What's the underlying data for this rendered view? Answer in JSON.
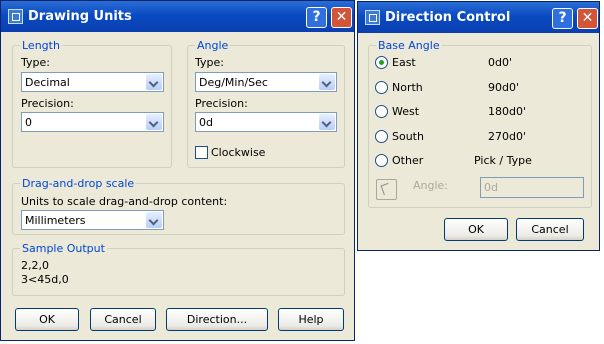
{
  "drawing_units": {
    "title": "Drawing Units",
    "help_label": "?",
    "close_label": "✕",
    "length": {
      "legend": "Length",
      "type_label": "Type:",
      "type_value": "Decimal",
      "precision_label": "Precision:",
      "precision_value": "0"
    },
    "angle": {
      "legend": "Angle",
      "type_label": "Type:",
      "type_value": "Deg/Min/Sec",
      "precision_label": "Precision:",
      "precision_value": "0d",
      "clockwise_label": "Clockwise",
      "clockwise_checked": false
    },
    "drag_drop": {
      "legend": "Drag-and-drop scale",
      "units_label": "Units to scale drag-and-drop content:",
      "units_value": "Millimeters"
    },
    "sample_output": {
      "legend": "Sample Output",
      "line1": "2,2,0",
      "line2": "3<45d,0"
    },
    "buttons": {
      "ok": "OK",
      "cancel": "Cancel",
      "direction": "Direction...",
      "help": "Help"
    }
  },
  "direction_control": {
    "title": "Direction Control",
    "help_label": "?",
    "close_label": "✕",
    "base_angle": {
      "legend": "Base Angle",
      "options": [
        {
          "label": "East",
          "value": "0d0'",
          "selected": true
        },
        {
          "label": "North",
          "value": "90d0'",
          "selected": false
        },
        {
          "label": "West",
          "value": "180d0'",
          "selected": false
        },
        {
          "label": "South",
          "value": "270d0'",
          "selected": false
        },
        {
          "label": "Other",
          "value": "Pick / Type",
          "selected": false
        }
      ],
      "angle_label": "Angle:",
      "angle_value": "0d"
    },
    "buttons": {
      "ok": "OK",
      "cancel": "Cancel"
    }
  }
}
